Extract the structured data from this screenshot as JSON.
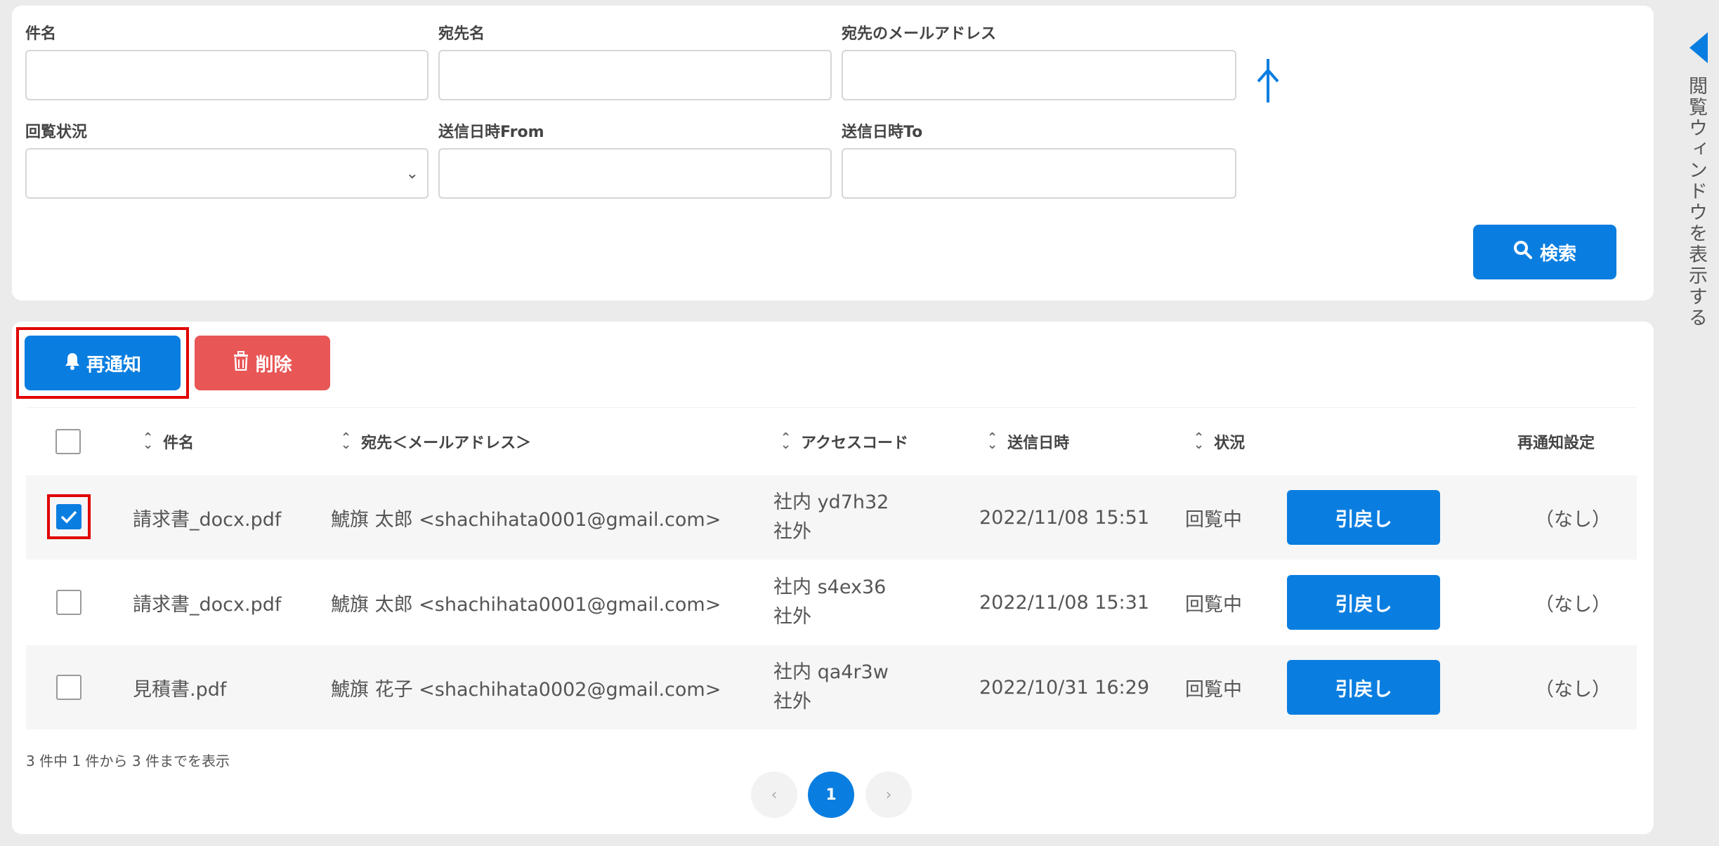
{
  "search": {
    "subject_label": "件名",
    "recipient_name_label": "宛先名",
    "recipient_email_label": "宛先のメールアドレス",
    "view_status_label": "回覧状況",
    "sent_from_label": "送信日時From",
    "sent_to_label": "送信日時To",
    "subject_value": "",
    "recipient_name_value": "",
    "recipient_email_value": "",
    "sent_from_value": "",
    "sent_to_value": "",
    "search_button": "検索"
  },
  "toolbar": {
    "renotify_button": "再通知",
    "delete_button": "削除"
  },
  "table": {
    "columns": {
      "subject": "件名",
      "recipient": "宛先＜メールアドレス＞",
      "access_code": "アクセスコード",
      "sent_at": "送信日時",
      "status": "状況",
      "renotify_setting": "再通知設定"
    },
    "rows": [
      {
        "checked": true,
        "subject": "請求書_docx.pdf",
        "recipient": "鯱旗 太郎 <shachihata0001@gmail.com>",
        "access_internal": "社内 yd7h32",
        "access_external": "社外",
        "sent_at": "2022/11/08 15:51",
        "status": "回覧中",
        "recall_button": "引戻し",
        "renotify_setting": "（なし）"
      },
      {
        "checked": false,
        "subject": "請求書_docx.pdf",
        "recipient": "鯱旗 太郎 <shachihata0001@gmail.com>",
        "access_internal": "社内 s4ex36",
        "access_external": "社外",
        "sent_at": "2022/11/08 15:31",
        "status": "回覧中",
        "recall_button": "引戻し",
        "renotify_setting": "（なし）"
      },
      {
        "checked": false,
        "subject": "見積書.pdf",
        "recipient": "鯱旗 花子 <shachihata0002@gmail.com>",
        "access_internal": "社内 qa4r3w",
        "access_external": "社外",
        "sent_at": "2022/10/31 16:29",
        "status": "回覧中",
        "recall_button": "引戻し",
        "renotify_setting": "（なし）"
      }
    ]
  },
  "pagination": {
    "summary": "3 件中 1 件から 3 件までを表示",
    "prev": "‹",
    "current_page": "1",
    "next": "›"
  },
  "side_panel": {
    "label": "閲覧ウィンドウを表示する"
  },
  "colors": {
    "primary": "#0a7ee0",
    "danger": "#e85656",
    "highlight": "#e00000"
  }
}
